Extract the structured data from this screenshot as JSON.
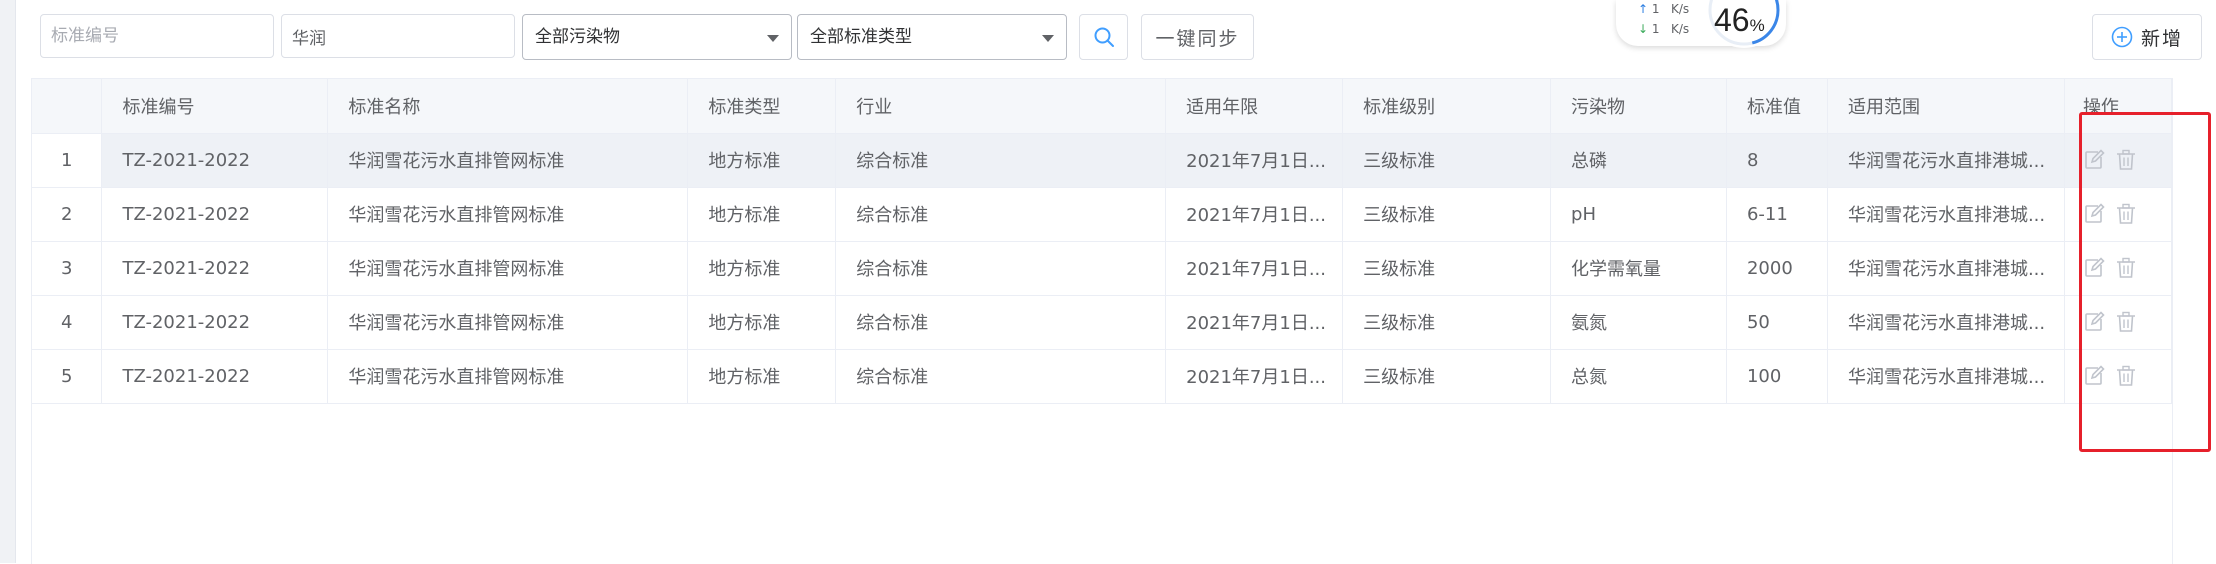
{
  "filters": {
    "standard_code_placeholder": "标准编号",
    "standard_name_value": "华润",
    "pollutant_select": "全部污染物",
    "standard_type_select": "全部标准类型",
    "sync_button": "一键同步",
    "add_button": "新增"
  },
  "network": {
    "up_value": "1",
    "up_unit": "K/s",
    "down_value": "1",
    "down_unit": "K/s",
    "usage_value": "46",
    "usage_unit": "%",
    "usage_percent": 46
  },
  "table": {
    "headers": [
      "",
      "标准编号",
      "标准名称",
      "标准类型",
      "行业",
      "适用年限",
      "标准级别",
      "污染物",
      "标准值",
      "适用范围",
      "操作"
    ],
    "rows": [
      [
        "1",
        "TZ-2021-2022",
        "华润雪花污水直排管网标准",
        "地方标准",
        "综合标准",
        "2021年7月1日...",
        "三级标准",
        "总磷",
        "8",
        "华润雪花污水直排港城..."
      ],
      [
        "2",
        "TZ-2021-2022",
        "华润雪花污水直排管网标准",
        "地方标准",
        "综合标准",
        "2021年7月1日...",
        "三级标准",
        "pH",
        "6-11",
        "华润雪花污水直排港城..."
      ],
      [
        "3",
        "TZ-2021-2022",
        "华润雪花污水直排管网标准",
        "地方标准",
        "综合标准",
        "2021年7月1日...",
        "三级标准",
        "化学需氧量",
        "2000",
        "华润雪花污水直排港城..."
      ],
      [
        "4",
        "TZ-2021-2022",
        "华润雪花污水直排管网标准",
        "地方标准",
        "综合标准",
        "2021年7月1日...",
        "三级标准",
        "氨氮",
        "50",
        "华润雪花污水直排港城..."
      ],
      [
        "5",
        "TZ-2021-2022",
        "华润雪花污水直排管网标准",
        "地方标准",
        "综合标准",
        "2021年7月1日...",
        "三级标准",
        "总氮",
        "100",
        "华润雪花污水直排港城..."
      ]
    ]
  },
  "colors": {
    "accent": "#409eff",
    "highlight_box": "#e6202b",
    "row_highlight": "#eef1f6"
  }
}
